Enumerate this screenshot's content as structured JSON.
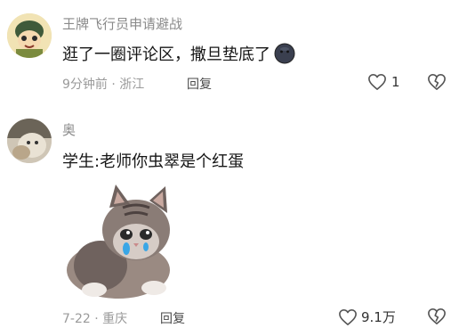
{
  "comments": [
    {
      "username": "王牌飞行员申请避战",
      "text": "逛了一圈评论区，撒旦垫底了",
      "emoji_icon": "dark-face-emoji",
      "meta": "9分钟前 · 浙江",
      "reply_label": "回复",
      "like_count": "1"
    },
    {
      "username": "奥",
      "text": "学生:老师你虫翠是个红蛋",
      "sticker_icon": "crying-kitten-sticker",
      "meta": "7-22 · 重庆",
      "reply_label": "回复",
      "like_count": "9.1万"
    }
  ],
  "icons": {
    "like": "heart-outline-icon",
    "dislike": "broken-heart-icon"
  },
  "colors": {
    "text": "#161616",
    "secondary": "#8a8a8a",
    "icon": "#555555"
  }
}
